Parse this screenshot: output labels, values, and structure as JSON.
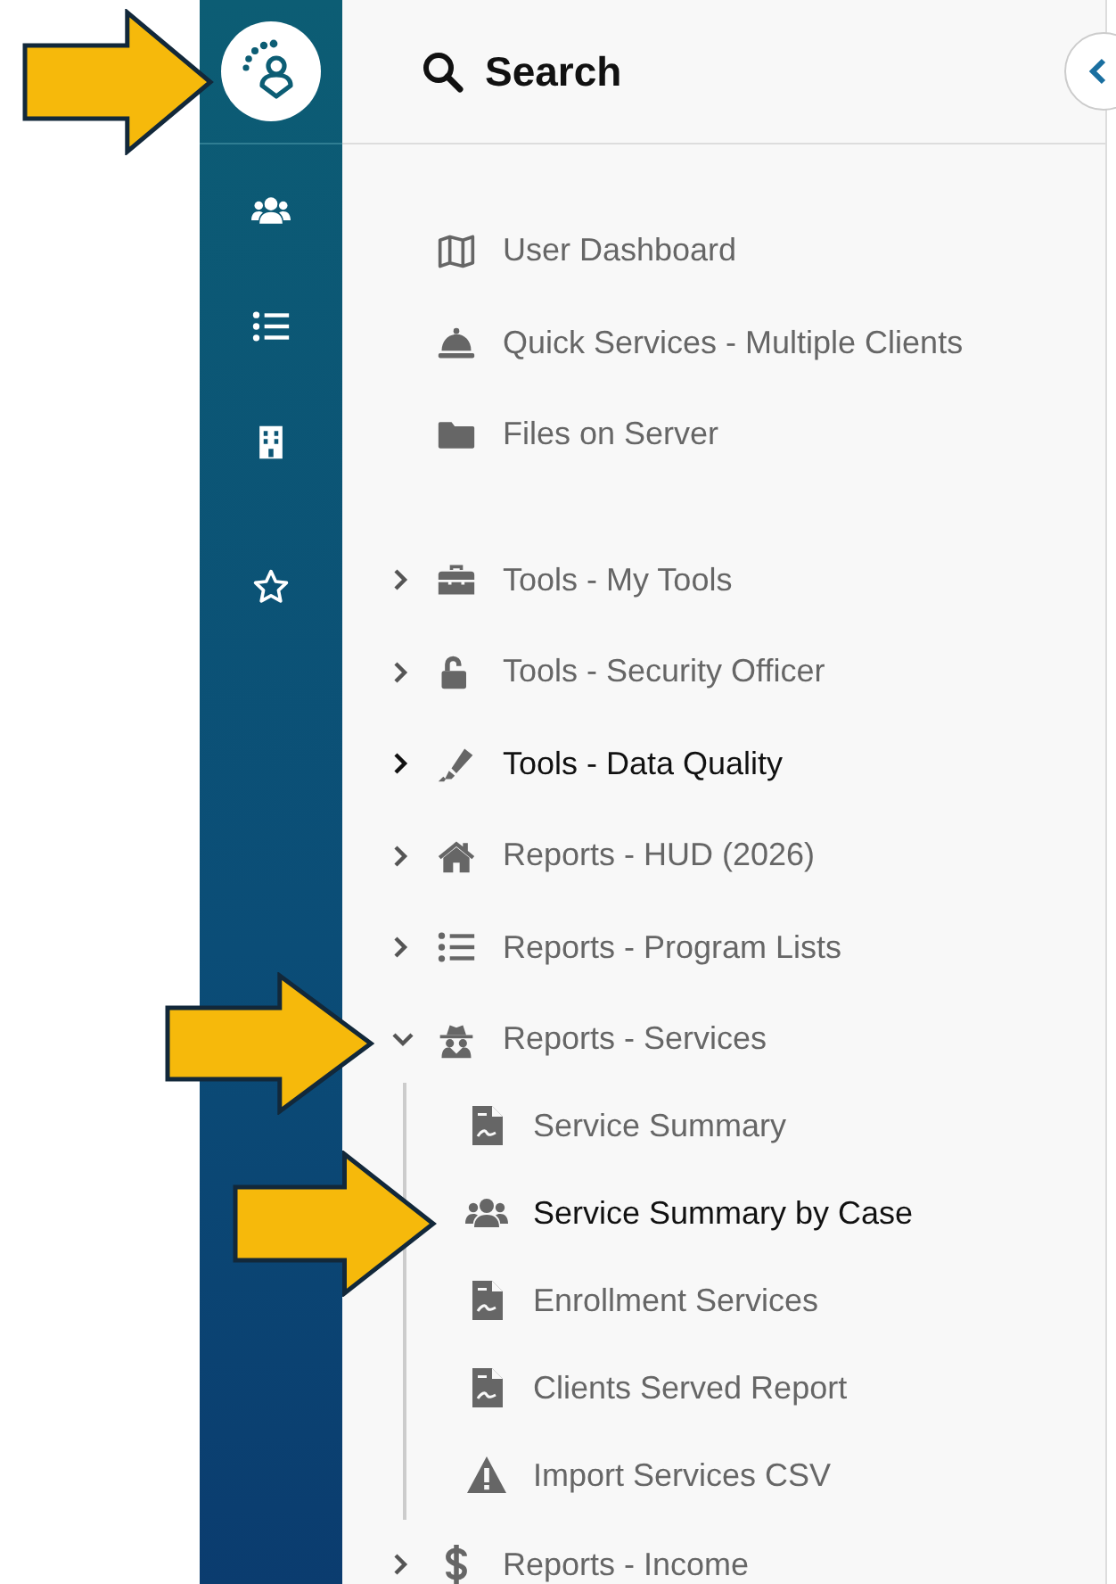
{
  "rail": {
    "items": [
      {
        "kind": "users"
      },
      {
        "kind": "list"
      },
      {
        "kind": "building"
      },
      {
        "kind": "star"
      }
    ]
  },
  "panel": {
    "title": "Search",
    "top_links": [
      {
        "kind": "map",
        "label": "User Dashboard",
        "emphasized": false
      },
      {
        "kind": "bell",
        "label": "Quick Services - Multiple Clients",
        "emphasized": false
      },
      {
        "kind": "folder",
        "label": "Files on Server",
        "emphasized": false
      }
    ],
    "sections": [
      {
        "kind": "toolbox",
        "label": "Tools - My Tools",
        "expanded": false,
        "emphasized": false
      },
      {
        "kind": "unlock",
        "label": "Tools - Security Officer",
        "expanded": false,
        "emphasized": false
      },
      {
        "kind": "marker",
        "label": "Tools - Data Quality",
        "expanded": false,
        "emphasized": true
      },
      {
        "kind": "house",
        "label": "Reports - HUD (2026)",
        "expanded": false,
        "emphasized": false
      },
      {
        "kind": "list",
        "label": "Reports - Program Lists",
        "expanded": false,
        "emphasized": false
      },
      {
        "kind": "spy",
        "label": "Reports - Services",
        "expanded": true,
        "emphasized": false,
        "children": [
          {
            "kind": "pdf",
            "label": "Service Summary",
            "emphasized": false
          },
          {
            "kind": "users",
            "label": "Service Summary by Case",
            "emphasized": true
          },
          {
            "kind": "pdf",
            "label": "Enrollment Services",
            "emphasized": false
          },
          {
            "kind": "pdf",
            "label": "Clients Served Report",
            "emphasized": false
          },
          {
            "kind": "warning",
            "label": "Import Services CSV",
            "emphasized": false
          }
        ]
      },
      {
        "kind": "dollar",
        "label": "Reports - Income",
        "expanded": false,
        "emphasized": false
      }
    ]
  }
}
